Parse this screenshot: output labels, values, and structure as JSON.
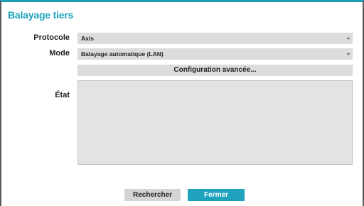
{
  "dialog": {
    "title": "Balayage tiers"
  },
  "protocol": {
    "label": "Protocole",
    "value": "Axis",
    "caret_icon": "triangle-down-icon"
  },
  "mode": {
    "label": "Mode",
    "value": "Balayage automatique (LAN)",
    "caret_icon": "triangle-down-icon"
  },
  "advanced": {
    "label": "Configuration avancée..."
  },
  "status": {
    "label": "État",
    "content": ""
  },
  "buttons": {
    "search": "Rechercher",
    "close": "Fermer"
  },
  "colors": {
    "accent": "#1fa3bd",
    "field_bg": "#dcdcdc",
    "status_bg": "#e3e3e3"
  }
}
